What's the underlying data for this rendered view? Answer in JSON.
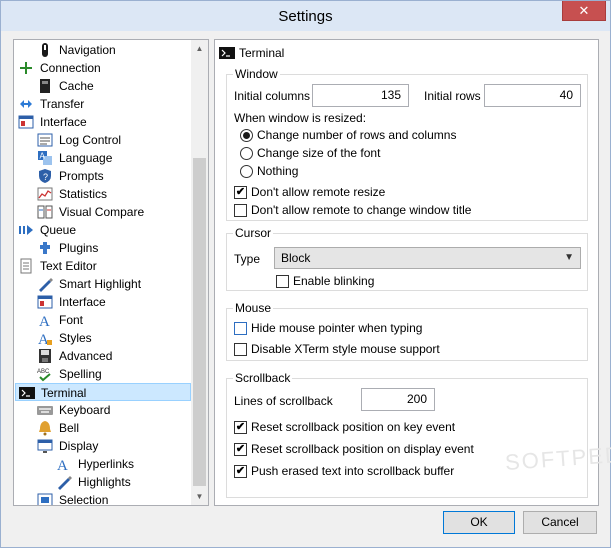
{
  "window": {
    "title": "Settings",
    "close_glyph": "✕"
  },
  "tree": {
    "items": [
      {
        "label": "Navigation",
        "icon": "navigation-icon",
        "level": 1
      },
      {
        "label": "Connection",
        "icon": "connection-icon",
        "level": 0
      },
      {
        "label": "Cache",
        "icon": "cache-icon",
        "level": 1
      },
      {
        "label": "Transfer",
        "icon": "transfer-icon",
        "level": 0
      },
      {
        "label": "Interface",
        "icon": "interface-icon",
        "level": 0
      },
      {
        "label": "Log Control",
        "icon": "log-control-icon",
        "level": 1
      },
      {
        "label": "Language",
        "icon": "language-icon",
        "level": 1
      },
      {
        "label": "Prompts",
        "icon": "prompts-icon",
        "level": 1
      },
      {
        "label": "Statistics",
        "icon": "statistics-icon",
        "level": 1
      },
      {
        "label": "Visual Compare",
        "icon": "visual-compare-icon",
        "level": 1
      },
      {
        "label": "Queue",
        "icon": "queue-icon",
        "level": 0
      },
      {
        "label": "Plugins",
        "icon": "plugins-icon",
        "level": 1
      },
      {
        "label": "Text Editor",
        "icon": "text-editor-icon",
        "level": 0
      },
      {
        "label": "Smart Highlight",
        "icon": "smart-highlight-icon",
        "level": 1
      },
      {
        "label": "Interface",
        "icon": "editor-interface-icon",
        "level": 1
      },
      {
        "label": "Font",
        "icon": "font-icon",
        "level": 1
      },
      {
        "label": "Styles",
        "icon": "styles-icon",
        "level": 1
      },
      {
        "label": "Advanced",
        "icon": "advanced-icon",
        "level": 1
      },
      {
        "label": "Spelling",
        "icon": "spelling-icon",
        "level": 1
      },
      {
        "label": "Terminal",
        "icon": "terminal-icon",
        "level": 0,
        "selected": true
      },
      {
        "label": "Keyboard",
        "icon": "keyboard-icon",
        "level": 1
      },
      {
        "label": "Bell",
        "icon": "bell-icon",
        "level": 1
      },
      {
        "label": "Display",
        "icon": "display-icon",
        "level": 1
      },
      {
        "label": "Hyperlinks",
        "icon": "hyperlinks-icon",
        "level": 2
      },
      {
        "label": "Highlights",
        "icon": "highlights-icon",
        "level": 2
      },
      {
        "label": "Selection",
        "icon": "selection-icon",
        "level": 1
      }
    ]
  },
  "panel": {
    "heading": "Terminal",
    "window_group": {
      "title": "Window",
      "initial_columns_label": "Initial columns",
      "initial_columns_value": "135",
      "initial_rows_label": "Initial rows",
      "initial_rows_value": "40",
      "resize_label": "When window is resized:",
      "resize_options": [
        {
          "label": "Change number of rows and columns",
          "selected": true
        },
        {
          "label": "Change size of the font",
          "selected": false
        },
        {
          "label": "Nothing",
          "selected": false
        }
      ],
      "dont_allow_resize": {
        "label": "Don't allow remote resize",
        "checked": true
      },
      "dont_allow_title": {
        "label": "Don't allow remote to change window title",
        "checked": false
      }
    },
    "cursor_group": {
      "title": "Cursor",
      "type_label": "Type",
      "type_value": "Block",
      "enable_blinking": {
        "label": "Enable blinking",
        "checked": false
      }
    },
    "mouse_group": {
      "title": "Mouse",
      "hide_pointer": {
        "label": "Hide mouse pointer when typing",
        "checked": false
      },
      "disable_xterm": {
        "label": "Disable XTerm style mouse support",
        "checked": false
      }
    },
    "scrollback_group": {
      "title": "Scrollback",
      "lines_label": "Lines of scrollback",
      "lines_value": "200",
      "reset_on_key": {
        "label": "Reset scrollback position on key event",
        "checked": true
      },
      "reset_on_display": {
        "label": "Reset scrollback position on display event",
        "checked": true
      },
      "push_erased": {
        "label": "Push erased text into scrollback buffer",
        "checked": true
      }
    }
  },
  "buttons": {
    "ok": "OK",
    "cancel": "Cancel"
  },
  "watermark": "SOFTPEDIA",
  "check_glyph": "✔",
  "colors": {
    "selection": "#cce8ff",
    "titlebar": "#dce7f5",
    "close": "#c75050",
    "default_button_border": "#0078d7"
  }
}
